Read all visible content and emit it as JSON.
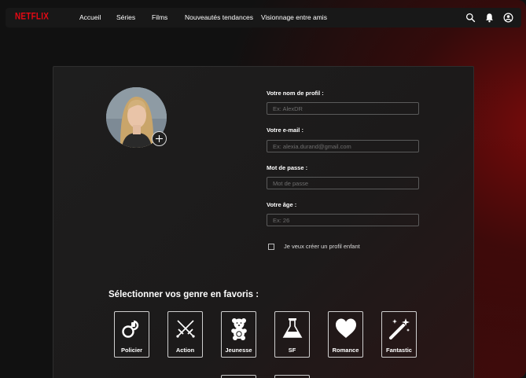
{
  "app": {
    "logo": "NETFLIX"
  },
  "nav": {
    "links": [
      "Accueil",
      "Séries",
      "Films",
      "Nouveautés tendances",
      "Visionnage entre amis"
    ]
  },
  "form": {
    "profile_name": {
      "label": "Votre nom de profil :",
      "placeholder": "Ex: AlexDR",
      "value": ""
    },
    "email": {
      "label": "Votre e-mail :",
      "placeholder": "Ex: alexia.durand@gmail.com",
      "value": ""
    },
    "password": {
      "label": "Mot de passe :",
      "placeholder": "Mot de passe",
      "value": ""
    },
    "age": {
      "label": "Votre âge :",
      "placeholder": "Ex: 26",
      "value": ""
    },
    "child_profile": {
      "label": "Je veux créer un profil enfant",
      "checked": false
    }
  },
  "genres": {
    "title": "Sélectionner vos genre en favoris :",
    "items": [
      {
        "label": "Policier",
        "icon": "handcuffs-icon"
      },
      {
        "label": "Action",
        "icon": "crossed-swords-icon"
      },
      {
        "label": "Jeunesse",
        "icon": "teddy-bear-icon"
      },
      {
        "label": "SF",
        "icon": "flask-icon"
      },
      {
        "label": "Romance",
        "icon": "heart-icon"
      },
      {
        "label": "Fantastic",
        "icon": "magic-wand-icon"
      }
    ]
  },
  "colors": {
    "brand": "#e50914",
    "background": "#111111",
    "accent_glow": "#8c0a0a"
  }
}
